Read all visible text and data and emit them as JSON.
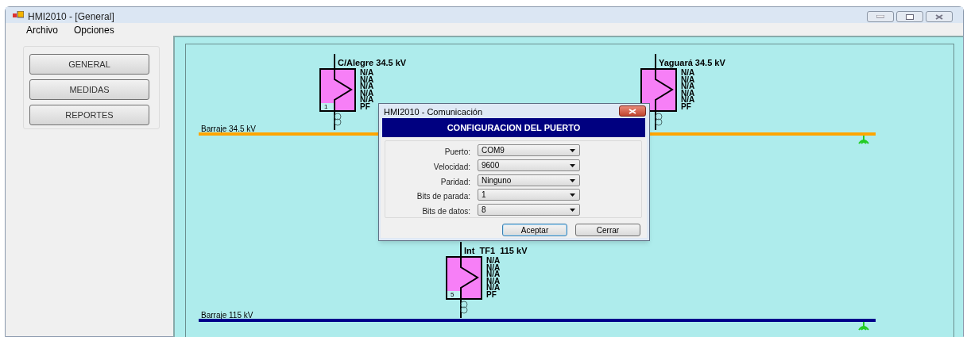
{
  "window": {
    "title": "HMI2010 - [General]"
  },
  "menu": [
    "Archivo",
    "Opciones"
  ],
  "nav_buttons": [
    "GENERAL",
    "MEDIDAS",
    "REPORTES"
  ],
  "diagram": {
    "buses": [
      {
        "label": "Barraje 34.5 kV",
        "color": "#ffa500"
      },
      {
        "label": "Barraje 115 kV",
        "color": "#00008b"
      }
    ],
    "breakers": [
      {
        "label": "C/Alegre 34.5 kV",
        "number": "1",
        "readings": [
          "N/A",
          "N/A",
          "N/A",
          "N/A",
          "N/A",
          "PF"
        ]
      },
      {
        "label": "Yaguará 34.5 kV",
        "readings": [
          "N/A",
          "N/A",
          "N/A",
          "N/A",
          "N/A",
          "PF"
        ]
      },
      {
        "label": "Int  TF1  115 kV",
        "number": "5",
        "readings": [
          "N/A",
          "N/A",
          "N/A",
          "N/A",
          "N/A",
          "PF"
        ]
      }
    ]
  },
  "dialog": {
    "title": "HMI2010 - Comunicación",
    "heading": "CONFIGURACION DEL PUERTO",
    "fields": [
      {
        "label": "Puerto:",
        "value": "COM9"
      },
      {
        "label": "Velocidad:",
        "value": "9600"
      },
      {
        "label": "Paridad:",
        "value": "Ninguno"
      },
      {
        "label": "Bits de parada:",
        "value": "1"
      },
      {
        "label": "Bits de datos:",
        "value": "8"
      }
    ],
    "buttons": [
      {
        "label": "Aceptar",
        "default": true
      },
      {
        "label": "Cerrar",
        "default": false
      }
    ]
  }
}
